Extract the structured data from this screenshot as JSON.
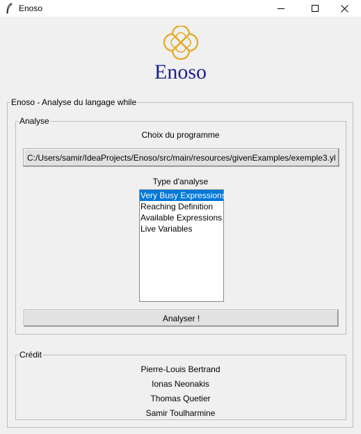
{
  "window": {
    "title": "Enoso"
  },
  "brand": {
    "name": "Enoso"
  },
  "main_group": {
    "legend": "Enoso - Analyse du langage while"
  },
  "analysis": {
    "legend": "Analyse",
    "program_label": "Choix du programme",
    "program_path": "C:/Users/samir/IdeaProjects/Enoso/src/main/resources/givenExamples/exemple3.yl",
    "type_label": "Type d'analyse",
    "types": [
      "Very Busy Expressions",
      "Reaching Definition",
      "Available Expressions",
      "Live Variables"
    ],
    "selected_type": "Very Busy Expressions",
    "run_label": "Analyser !"
  },
  "credits": {
    "legend": "Crédit",
    "names": [
      "Pierre-Louis Bertrand",
      "Ionas Neonakis",
      "Thomas Quetier",
      "Samir Toulharmine"
    ]
  },
  "colors": {
    "brand": "#1a1f8c",
    "logo": "#e3ac2a",
    "selection": "#0078d7"
  }
}
